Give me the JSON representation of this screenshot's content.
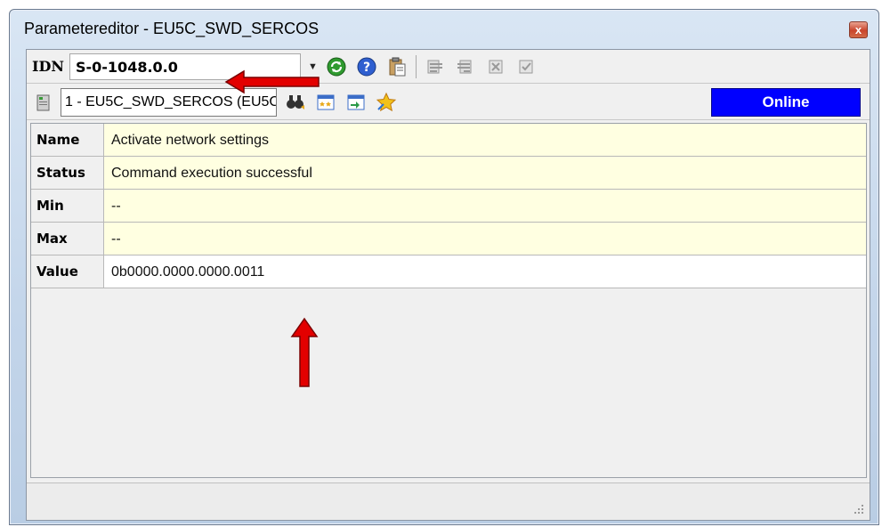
{
  "window": {
    "title": "Parametereditor - EU5C_SWD_SERCOS",
    "close_glyph": "x"
  },
  "toolbar": {
    "idn_label": "IDN",
    "idn_value": "S-0-1048.0.0",
    "icons": [
      "refresh-icon",
      "help-icon",
      "clipboard-icon",
      "param-list-icon",
      "param-list-2-icon",
      "compare-icon",
      "check-icon"
    ]
  },
  "connection": {
    "device": "1 - EU5C_SWD_SERCOS (EU5C",
    "status": "Online",
    "status_color": "#0000ff"
  },
  "parameter": {
    "rows": [
      {
        "label": "Name",
        "value": "Activate network settings"
      },
      {
        "label": "Status",
        "value": "Command execution successful"
      },
      {
        "label": "Min",
        "value": "--"
      },
      {
        "label": "Max",
        "value": "--"
      },
      {
        "label": "Value",
        "value": "0b0000.0000.0000.0011"
      }
    ]
  },
  "annotation_color": "#e30000"
}
